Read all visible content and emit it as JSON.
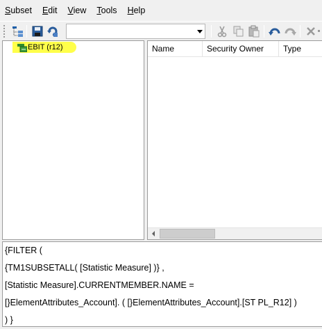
{
  "menu": {
    "items": [
      {
        "label": "Subset",
        "accel": "S",
        "rest": "ubset"
      },
      {
        "label": "Edit",
        "accel": "E",
        "rest": "dit"
      },
      {
        "label": "View",
        "accel": "V",
        "rest": "iew"
      },
      {
        "label": "Tools",
        "accel": "T",
        "rest": "ools"
      },
      {
        "label": "Help",
        "accel": "H",
        "rest": "elp"
      }
    ]
  },
  "toolbar": {
    "combo_value": "",
    "icons": [
      "tree-view-icon",
      "save-icon",
      "refresh-icon",
      "cut-icon",
      "copy-icon",
      "paste-icon",
      "undo-icon",
      "redo-icon",
      "delete-icon"
    ]
  },
  "tree": {
    "node_label": "EBIT (r12)"
  },
  "list": {
    "columns": [
      "Name",
      "Security Owner",
      "Type"
    ]
  },
  "expression": {
    "lines": [
      "{FILTER (",
      "{TM1SUBSETALL( [Statistic Measure] )} ,",
      "[Statistic Measure].CURRENTMEMBER.NAME =",
      "[}ElementAttributes_Account]. ( [}ElementAttributes_Account].[ST PL_R12] )",
      ") }"
    ]
  },
  "colors": {
    "highlight": "#ffff4a",
    "background": "#f0f0f0"
  }
}
